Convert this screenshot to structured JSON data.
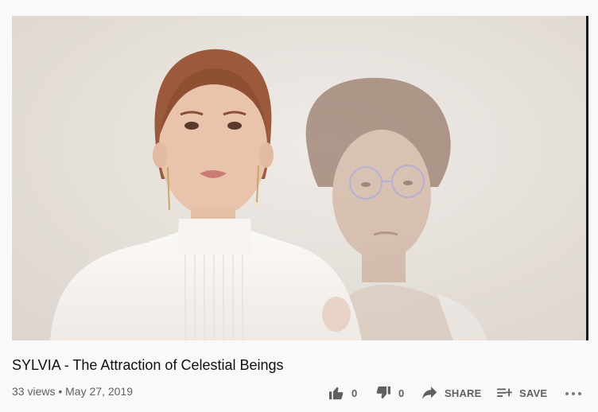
{
  "video": {
    "thumbnail_alt": "Music video frame: woman in white blouse in front of a faded double-exposed young man, pale wall background",
    "title": "SYLVIA - The Attraction of Celestial Beings",
    "views": "33 views",
    "separator": "•",
    "date": "May 27, 2019",
    "meta_line": "33 views • May 27, 2019"
  },
  "actions": {
    "like": {
      "icon": "thumbs-up-icon",
      "count": "0"
    },
    "dislike": {
      "icon": "thumbs-down-icon",
      "count": "0"
    },
    "share": {
      "icon": "share-arrow-icon",
      "label": "SHARE"
    },
    "save": {
      "icon": "playlist-add-icon",
      "label": "SAVE"
    },
    "more": {
      "icon": "more-horizontal-icon"
    }
  },
  "colors": {
    "page_bg": "#f9f9f9",
    "title_text": "#0f0f0f",
    "secondary_text": "#606060",
    "icon": "#606060"
  }
}
